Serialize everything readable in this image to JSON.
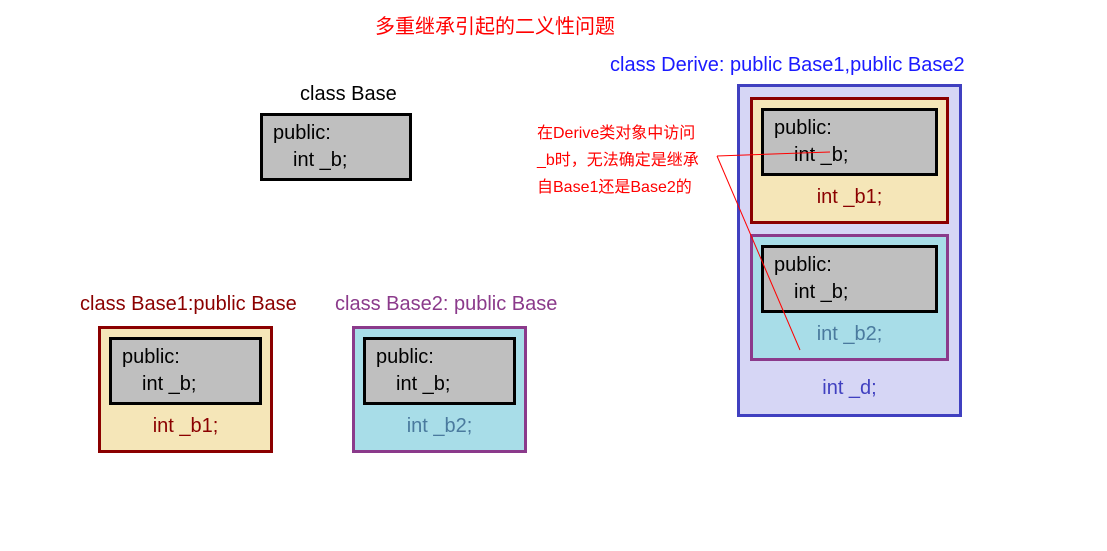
{
  "title": "多重继承引起的二义性问题",
  "base": {
    "label": "class Base",
    "access": "public:",
    "member": "int _b;"
  },
  "base1": {
    "label": "class Base1:public Base",
    "access": "public:",
    "inherited": "int _b;",
    "own": "int _b1;"
  },
  "base2": {
    "label": "class Base2: public Base",
    "access": "public:",
    "inherited": "int _b;",
    "own": "int _b2;"
  },
  "derive": {
    "label": "class Derive: public Base1,public Base2",
    "sub1": {
      "access": "public:",
      "inherited": "int _b;",
      "own": "int _b1;"
    },
    "sub2": {
      "access": "public:",
      "inherited": "int _b;",
      "own": "int _b2;"
    },
    "own": "int _d;"
  },
  "annotation": {
    "line1": "在Derive类对象中访问",
    "line2": "_b时，无法确定是继承",
    "line3": "自Base1还是Base2的"
  },
  "colors": {
    "title": "#ff0000",
    "base1_border": "#8b0000",
    "base1_bg": "#f5e6b8",
    "base2_border": "#8b3a8b",
    "base2_bg": "#a8dde8",
    "derive_border": "#4040c0",
    "derive_bg": "#d6d6f5",
    "derive_label": "#1a1aff",
    "inner_bg": "#bfbfbf",
    "annotation": "#ff0000"
  }
}
